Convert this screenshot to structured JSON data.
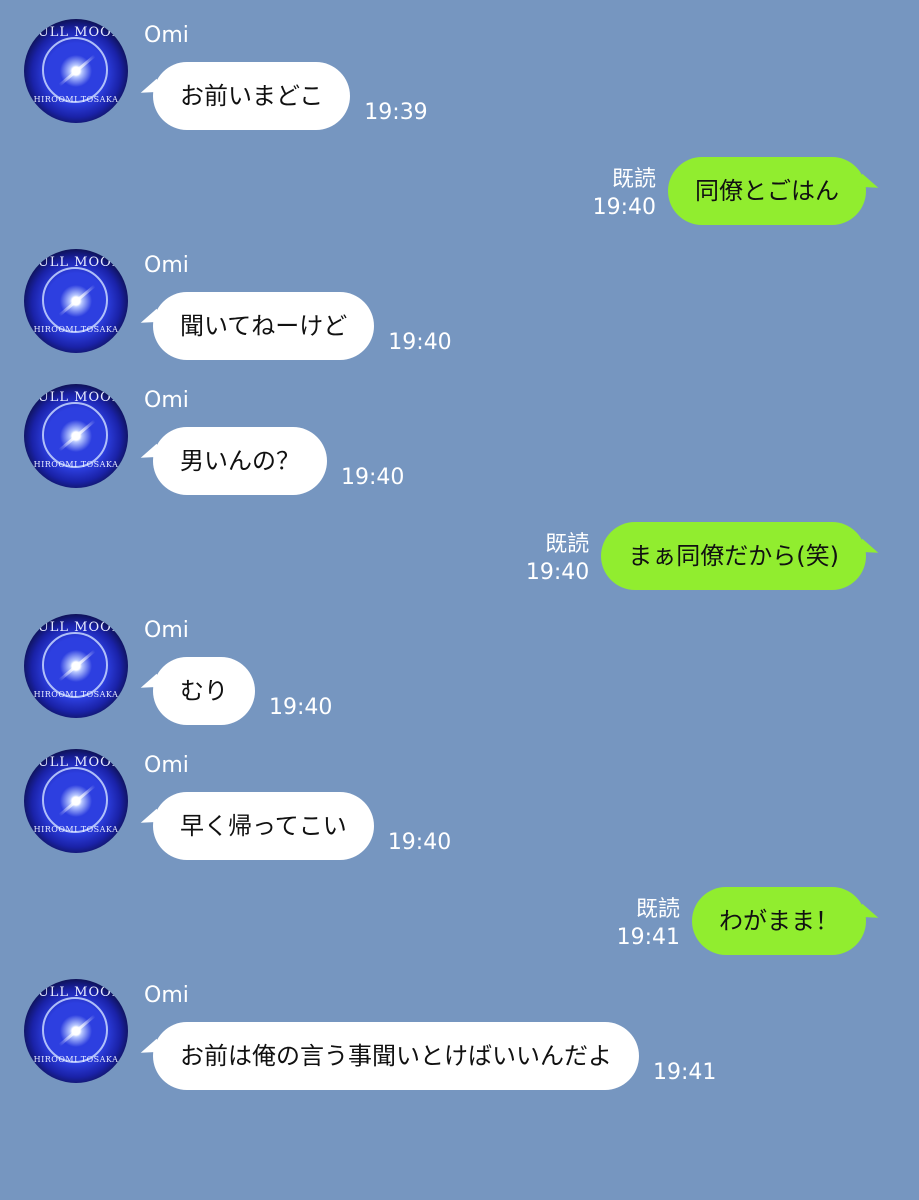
{
  "colors": {
    "background": "#7696c0",
    "outgoing_bubble": "#91ed2f",
    "incoming_bubble": "#ffffff"
  },
  "avatar": {
    "top_text": "FULL MOON",
    "bottom_text": "HIROOMI TOSAKA"
  },
  "messages": [
    {
      "sender": "Omi",
      "text": "お前いまどこ",
      "time": "19:39"
    },
    {
      "text": "同僚とごはん",
      "read": "既読",
      "time": "19:40"
    },
    {
      "sender": "Omi",
      "text": "聞いてねーけど",
      "time": "19:40"
    },
    {
      "sender": "Omi",
      "text": "男いんの？",
      "time": "19:40"
    },
    {
      "text": "まぁ同僚だから(笑)",
      "read": "既読",
      "time": "19:40"
    },
    {
      "sender": "Omi",
      "text": "むり",
      "time": "19:40"
    },
    {
      "sender": "Omi",
      "text": "早く帰ってこい",
      "time": "19:40"
    },
    {
      "text": "わがまま！",
      "read": "既読",
      "time": "19:41"
    },
    {
      "sender": "Omi",
      "text": "お前は俺の言う事聞いとけばいいんだよ",
      "time": "19:41"
    }
  ]
}
